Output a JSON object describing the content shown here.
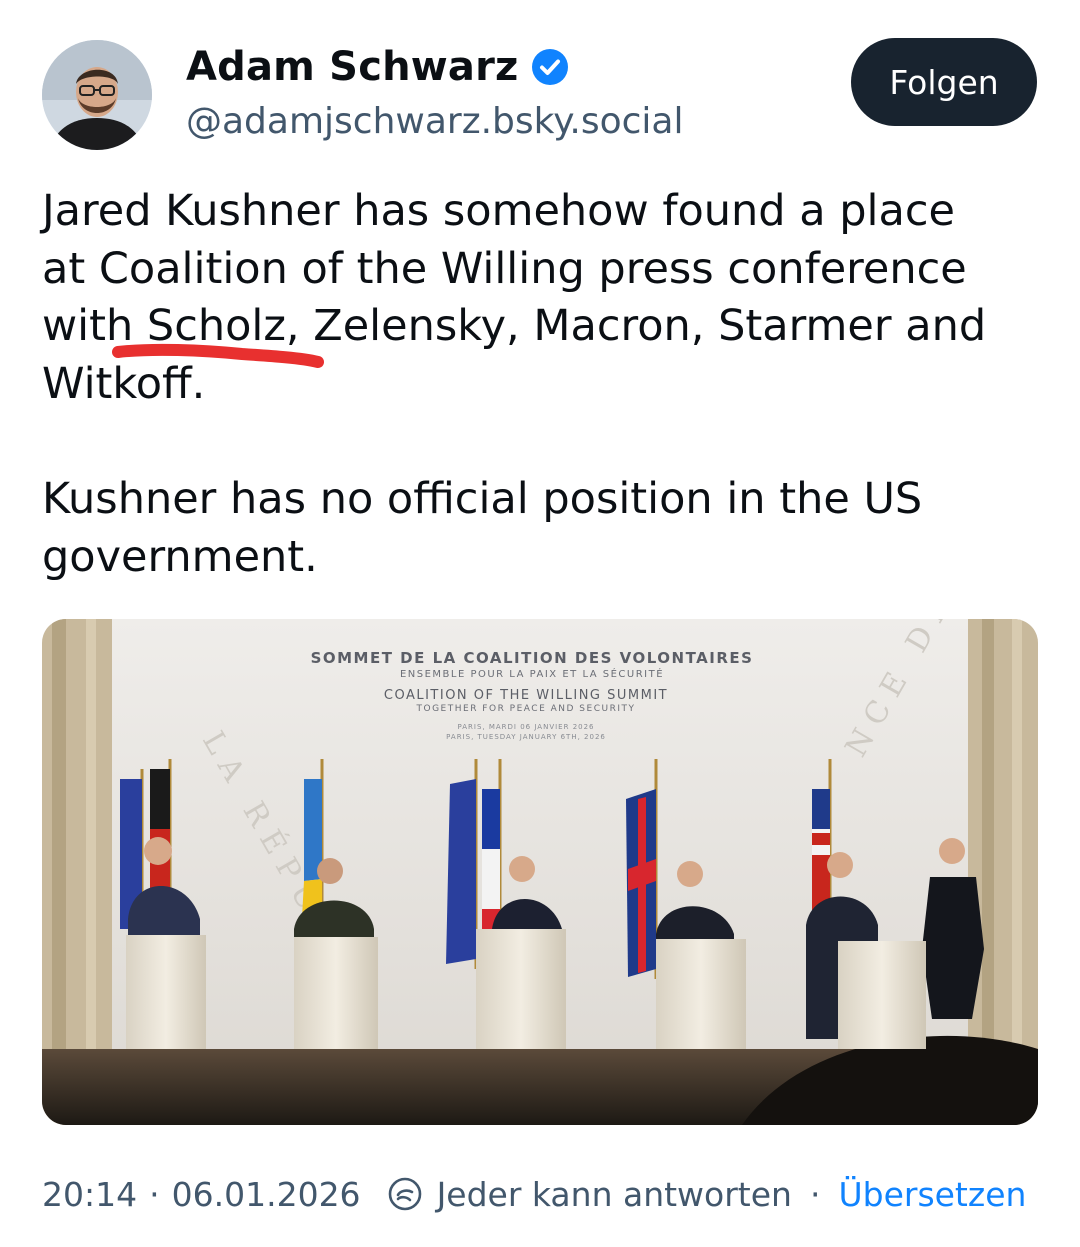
{
  "author": {
    "name": "Adam Schwarz",
    "handle": "@adamjschwarz.bsky.social",
    "verified": true
  },
  "follow_button": {
    "label": "Folgen"
  },
  "post": {
    "line1": "Jared Kushner has somehow found a place",
    "line2": "at Coalition of the Willing press conference",
    "line3": "with Scholz, Zelensky, Macron, Starmer and",
    "line4": "Witkoff.",
    "line5": "Kushner has no official position in the US",
    "line6": "government."
  },
  "media": {
    "banner_line1": "SOMMET DE LA COALITION DES VOLONTAIRES",
    "banner_line2": "ENSEMBLE POUR LA PAIX ET LA SÉCURITÉ",
    "banner_line3": "COALITION OF THE WILLING SUMMIT",
    "banner_line4": "TOGETHER FOR PEACE AND SECURITY",
    "banner_line5": "PARIS, MARDI 06 JANVIER 2026",
    "banner_line6": "PARIS, TUESDAY JANUARY 6TH, 2026",
    "wall_left": "LA RÉPUBL",
    "wall_right": "NCE DE"
  },
  "footer": {
    "time": "20:14",
    "separator": "·",
    "date": "06.01.2026",
    "reply_setting": "Jeder kann antworten",
    "separator2": "·",
    "translate_label": "Übersetzen"
  },
  "colors": {
    "follow_bg": "#18232f",
    "verified_blue": "#1083fe",
    "link_blue": "#1083fe",
    "secondary_text": "#42576c",
    "scribble_red": "#e8302f"
  },
  "icons": [
    "verified-badge-icon",
    "reply-restriction-icon"
  ]
}
